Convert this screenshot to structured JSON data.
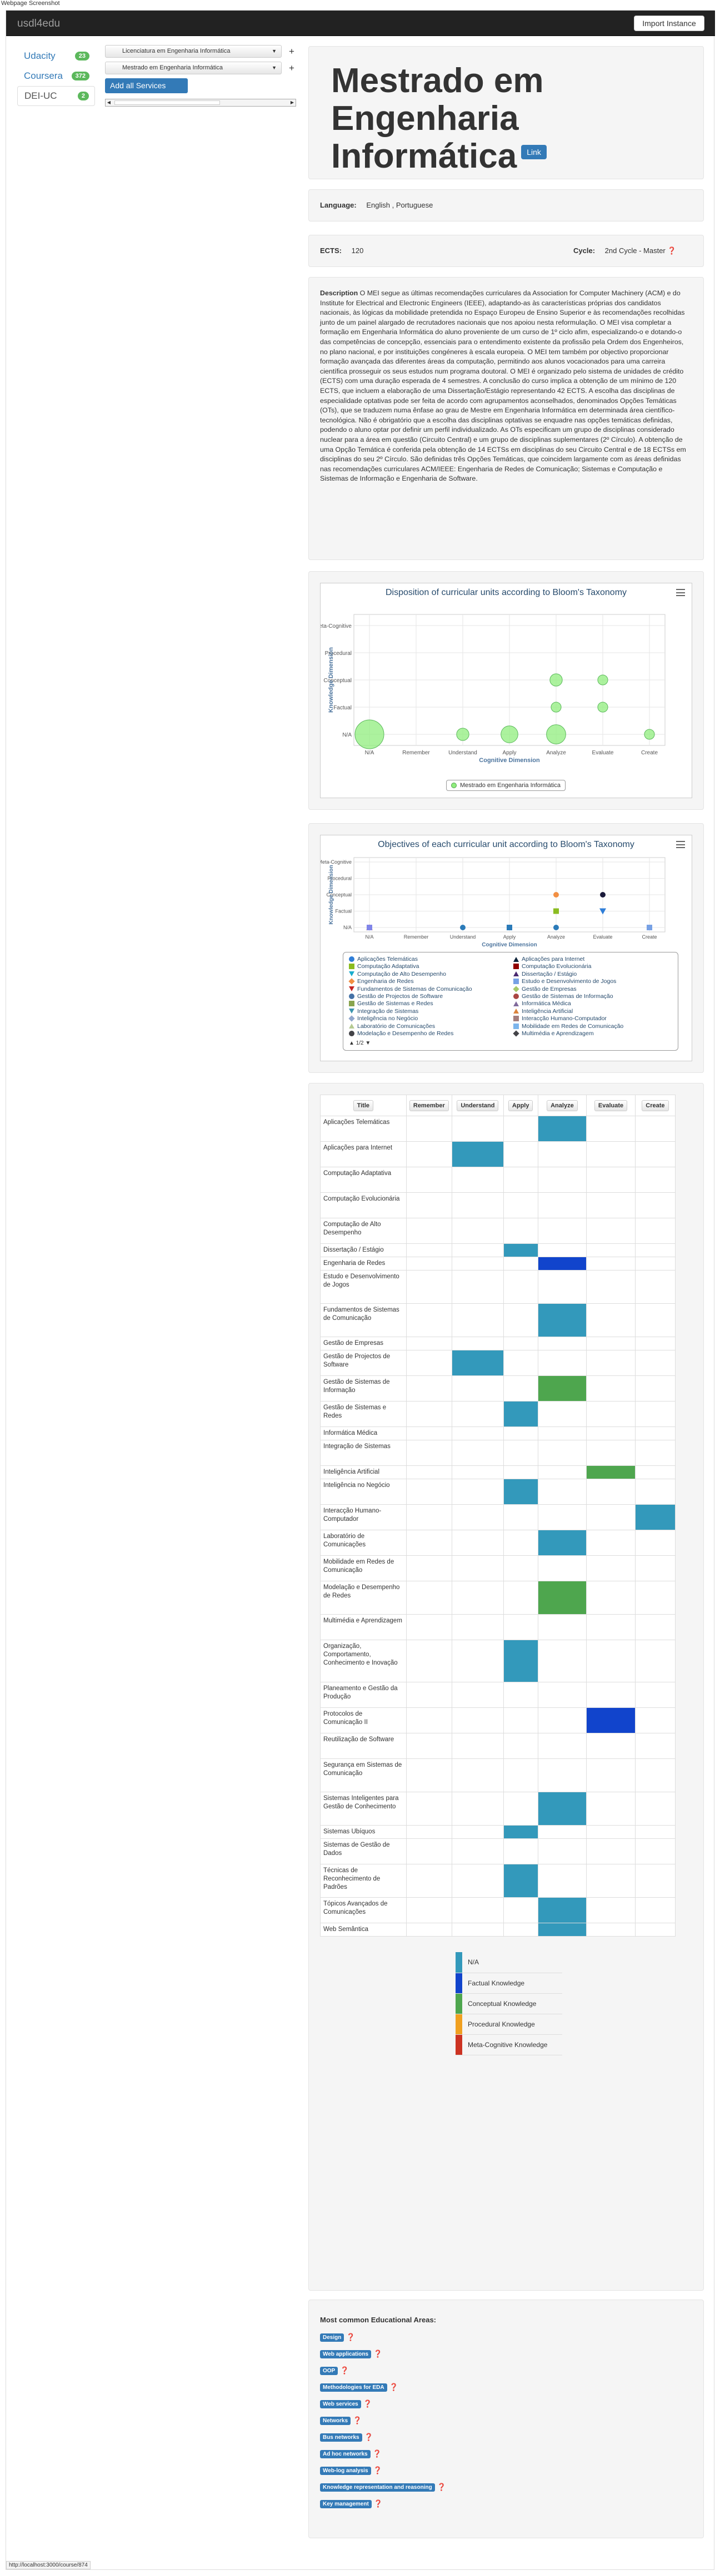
{
  "page_caption": "Webpage Screenshot",
  "navbar": {
    "brand": "usdl4edu",
    "import_button": "Import Instance"
  },
  "sidebar": {
    "items": [
      {
        "label": "Udacity",
        "count": "23"
      },
      {
        "label": "Coursera",
        "count": "372"
      },
      {
        "label": "DEI-UC",
        "count": "2"
      }
    ]
  },
  "courses": {
    "selected": [
      "Licenciatura em Engenharia Informática",
      "Mestrado em Engenharia Informática"
    ],
    "add_button": "Add all Services"
  },
  "header": {
    "title": "Mestrado em Engenharia Informática",
    "link_label": "Link"
  },
  "language": {
    "label": "Language:",
    "value": "English , Portuguese"
  },
  "ects": {
    "label": "ECTS:",
    "value": "120",
    "cycle_label": "Cycle:",
    "cycle_value": "2nd Cycle - Master"
  },
  "description": {
    "label": "Description",
    "text": "O MEI segue as últimas recomendações curriculares da Association for Computer Machinery (ACM) e do Institute for Electrical and Electronic Engineers (IEEE), adaptando-as às características próprias dos candidatos nacionais, às lógicas da mobilidade pretendida no Espaço Europeu de Ensino Superior e às recomendações recolhidas junto de um painel alargado de recrutadores nacionais que nos apoiou nesta reformulação. O MEI visa completar a formação em Engenharia Informática do aluno proveniente de um curso de 1º ciclo afim, especializando-o e dotando-o das competências de concepção, essenciais para o entendimento existente da profissão pela Ordem dos Engenheiros, no plano nacional, e por instituições congéneres à escala europeia. O MEI tem também por objectivo proporcionar formação avançada das diferentes áreas da computação, permitindo aos alunos vocacionados para uma carreira científica prosseguir os seus estudos num programa doutoral. O MEI é organizado pelo sistema de unidades de crédito (ECTS) com uma duração esperada de 4 semestres. A conclusão do curso implica a obtenção de um mínimo de 120 ECTS, que incluem a elaboração de uma Dissertação/Estágio representando 42 ECTS. A escolha das disciplinas de especialidade optativas pode ser feita de acordo com agrupamentos aconselhados, denominados Opções Temáticas (OTs), que se traduzem numa ênfase ao grau de Mestre em Engenharia Informática em determinada área científico-tecnológica. Não é obrigatório que a escolha das disciplinas optativas se enquadre nas opções temáticas definidas, podendo o aluno optar por definir um perfil individualizado. As OTs especificam um grupo de disciplinas considerado nuclear para a área em questão (Circuito Central) e um grupo de disciplinas suplementares (2º Círculo). A obtenção de uma Opção Temática é conferida pela obtenção de 14 ECTSs em disciplinas do seu Circuito Central e de 18 ECTSs em disciplinas do seu 2º Círculo. São definidas três Opções Temáticas, que coincidem largamente com as áreas definidas nas recomendações curriculares ACM/IEEE: Engenharia de Redes de Comunicação; Sistemas e Computação e Sistemas de Informação e Engenharia de Software."
  },
  "chart_data": [
    {
      "type": "scatter",
      "title": "Disposition of curricular units according to Bloom's Taxonomy",
      "xlabel": "Cognitive Dimension",
      "ylabel": "Knowledge Dimension",
      "x_categories": [
        "N/A",
        "Remember",
        "Understand",
        "Apply",
        "Analyze",
        "Evaluate",
        "Create"
      ],
      "y_categories": [
        "N/A",
        "Factual",
        "Conceptual",
        "Procedural",
        "Meta-Cognitive"
      ],
      "series": [
        {
          "name": "Mestrado em Engenharia Informática",
          "color": "#90ed7d",
          "points": [
            {
              "x": "N/A",
              "y": "N/A",
              "size": 19
            },
            {
              "x": "Understand",
              "y": "N/A",
              "size": 2
            },
            {
              "x": "Apply",
              "y": "N/A",
              "size": 5
            },
            {
              "x": "Analyze",
              "y": "N/A",
              "size": 7
            },
            {
              "x": "Create",
              "y": "N/A",
              "size": 1
            },
            {
              "x": "Analyze",
              "y": "Factual",
              "size": 1
            },
            {
              "x": "Evaluate",
              "y": "Factual",
              "size": 1
            },
            {
              "x": "Analyze",
              "y": "Conceptual",
              "size": 2
            },
            {
              "x": "Evaluate",
              "y": "Conceptual",
              "size": 1
            }
          ]
        }
      ]
    },
    {
      "type": "scatter",
      "title": "Objectives of each curricular unit according to Bloom's Taxonomy",
      "xlabel": "Cognitive Dimension",
      "ylabel": "Knowledge Dimension",
      "x_categories": [
        "N/A",
        "Remember",
        "Understand",
        "Apply",
        "Analyze",
        "Evaluate",
        "Create"
      ],
      "y_categories": [
        "N/A",
        "Factual",
        "Conceptual",
        "Procedural",
        "Meta-Cognitive"
      ],
      "points": [
        {
          "x": "N/A",
          "y": "N/A",
          "color": "#f7a35c",
          "shape": "triangle"
        },
        {
          "x": "N/A",
          "y": "N/A",
          "color": "#8085e9",
          "shape": "square"
        },
        {
          "x": "Understand",
          "y": "N/A",
          "color": "#2b7bb9",
          "shape": "circle"
        },
        {
          "x": "Apply",
          "y": "N/A",
          "color": "#2b7bb9",
          "shape": "square"
        },
        {
          "x": "Analyze",
          "y": "N/A",
          "color": "#2b7bb9",
          "shape": "circle"
        },
        {
          "x": "Analyze",
          "y": "Factual",
          "color": "#8bbc21",
          "shape": "square"
        },
        {
          "x": "Evaluate",
          "y": "Factual",
          "color": "#2f7ed8",
          "shape": "triangle-down"
        },
        {
          "x": "Analyze",
          "y": "Conceptual",
          "color": "#f28f43",
          "shape": "circle"
        },
        {
          "x": "Evaluate",
          "y": "Conceptual",
          "color": "#1a1a3a",
          "shape": "circle"
        },
        {
          "x": "Create",
          "y": "N/A",
          "color": "#77a1e5",
          "shape": "square"
        }
      ],
      "legend": {
        "entries": [
          {
            "name": "Aplicações Telemáticas",
            "color": "#2f7ed8",
            "shape": "circle"
          },
          {
            "name": "Aplicações para Internet",
            "color": "#0d233a",
            "shape": "triangle"
          },
          {
            "name": "Computação Adaptativa",
            "color": "#8bbc21",
            "shape": "square"
          },
          {
            "name": "Computação Evolucionária",
            "color": "#910000",
            "shape": "square"
          },
          {
            "name": "Computação de Alto Desempenho",
            "color": "#1aadce",
            "shape": "triangle-down"
          },
          {
            "name": "Dissertação / Estágio",
            "color": "#492970",
            "shape": "triangle"
          },
          {
            "name": "Engenharia de Redes",
            "color": "#f28f43",
            "shape": "diamond"
          },
          {
            "name": "Estudo e Desenvolvimento de Jogos",
            "color": "#77a1e5",
            "shape": "square"
          },
          {
            "name": "Fundamentos de Sistemas de Comunicação",
            "color": "#c42525",
            "shape": "triangle-down"
          },
          {
            "name": "Gestão de Empresas",
            "color": "#a6c96a",
            "shape": "diamond"
          },
          {
            "name": "Gestão de Projectos de Software",
            "color": "#4572a7",
            "shape": "circle"
          },
          {
            "name": "Gestão de Sistemas de Informação",
            "color": "#aa4643",
            "shape": "circle"
          },
          {
            "name": "Gestão de Sistemas e Redes",
            "color": "#89a54e",
            "shape": "square"
          },
          {
            "name": "Informática Médica",
            "color": "#80699b",
            "shape": "triangle"
          },
          {
            "name": "Integração de Sistemas",
            "color": "#3d96ae",
            "shape": "triangle-down"
          },
          {
            "name": "Inteligência Artificial",
            "color": "#db843d",
            "shape": "triangle"
          },
          {
            "name": "Inteligência no Negócio",
            "color": "#92a8cd",
            "shape": "diamond"
          },
          {
            "name": "Interacção Humano-Computador",
            "color": "#a47d7c",
            "shape": "square"
          },
          {
            "name": "Laboratório de Comunicações",
            "color": "#b5ca92",
            "shape": "triangle"
          },
          {
            "name": "Mobilidade em Redes de Comunicação",
            "color": "#7cb5ec",
            "shape": "square"
          },
          {
            "name": "Modelação e Desempenho de Redes",
            "color": "#434348",
            "shape": "circle"
          },
          {
            "name": "Multimédia e Aprendizagem",
            "color": "#434348",
            "shape": "diamond"
          }
        ],
        "pager": "1/2"
      }
    }
  ],
  "table": {
    "headers": [
      "Title",
      "Remember",
      "Understand",
      "Apply",
      "Analyze",
      "Evaluate",
      "Create"
    ],
    "rows": [
      {
        "title": "Aplicações Telemáticas",
        "cells": [
          "",
          "",
          "",
          "c0",
          "",
          ""
        ],
        "h": 2
      },
      {
        "title": "Aplicações para Internet",
        "cells": [
          "",
          "c0",
          "",
          "",
          "",
          ""
        ],
        "h": 2
      },
      {
        "title": "Computação Adaptativa",
        "cells": [
          "",
          "",
          "",
          "",
          "",
          ""
        ],
        "h": 2
      },
      {
        "title": "Computação Evolucionária",
        "cells": [
          "",
          "",
          "",
          "",
          "",
          ""
        ],
        "h": 2
      },
      {
        "title": "Computação de Alto Desempenho",
        "cells": [
          "",
          "",
          "",
          "",
          "",
          ""
        ],
        "h": 2
      },
      {
        "title": "Dissertação / Estágio",
        "cells": [
          "",
          "",
          "c0",
          "",
          "",
          ""
        ],
        "h": 1
      },
      {
        "title": "Engenharia de Redes",
        "cells": [
          "",
          "",
          "",
          "c1",
          "",
          ""
        ],
        "h": 1
      },
      {
        "title": "Estudo e Desenvolvimento de Jogos",
        "cells": [
          "",
          "",
          "",
          "",
          "",
          ""
        ],
        "h": 3
      },
      {
        "title": "Fundamentos de Sistemas de Comunicação",
        "cells": [
          "",
          "",
          "",
          "c0",
          "",
          ""
        ],
        "h": 3
      },
      {
        "title": "Gestão de Empresas",
        "cells": [
          "",
          "",
          "",
          "",
          "",
          ""
        ],
        "h": 1
      },
      {
        "title": "Gestão de Projectos de Software",
        "cells": [
          "",
          "c0",
          "",
          "",
          "",
          ""
        ],
        "h": 2
      },
      {
        "title": "Gestão de Sistemas de Informação",
        "cells": [
          "",
          "",
          "",
          "c2",
          "",
          ""
        ],
        "h": 2
      },
      {
        "title": "Gestão de Sistemas e Redes",
        "cells": [
          "",
          "",
          "c0",
          "",
          "",
          ""
        ],
        "h": 2
      },
      {
        "title": "Informática Médica",
        "cells": [
          "",
          "",
          "",
          "",
          "",
          ""
        ],
        "h": 1
      },
      {
        "title": "Integração de Sistemas",
        "cells": [
          "",
          "",
          "",
          "",
          "",
          ""
        ],
        "h": 2
      },
      {
        "title": "Inteligência Artificial",
        "cells": [
          "",
          "",
          "",
          "",
          "c2",
          ""
        ],
        "h": 1
      },
      {
        "title": "Inteligência no Negócio",
        "cells": [
          "",
          "",
          "c0",
          "",
          "",
          ""
        ],
        "h": 2
      },
      {
        "title": "Interacção Humano-Computador",
        "cells": [
          "",
          "",
          "",
          "",
          "",
          "c0"
        ],
        "h": 2
      },
      {
        "title": "Laboratório de Comunicações",
        "cells": [
          "",
          "",
          "",
          "c0",
          "",
          ""
        ],
        "h": 2
      },
      {
        "title": "Mobilidade em Redes de Comunicação",
        "cells": [
          "",
          "",
          "",
          "",
          "",
          ""
        ],
        "h": 2
      },
      {
        "title": "Modelação e Desempenho de Redes",
        "cells": [
          "",
          "",
          "",
          "c2",
          "",
          ""
        ],
        "h": 3
      },
      {
        "title": "Multimédia e Aprendizagem",
        "cells": [
          "",
          "",
          "",
          "",
          "",
          ""
        ],
        "h": 2
      },
      {
        "title": "Organização, Comportamento, Conhecimento e Inovação",
        "cells": [
          "",
          "",
          "c0",
          "",
          "",
          ""
        ],
        "h": 4
      },
      {
        "title": "Planeamento e Gestão da Produção",
        "cells": [
          "",
          "",
          "",
          "",
          "",
          ""
        ],
        "h": 2
      },
      {
        "title": "Protocolos de Comunicação II",
        "cells": [
          "",
          "",
          "",
          "",
          "c1",
          ""
        ],
        "h": 2
      },
      {
        "title": "Reutilização de Software",
        "cells": [
          "",
          "",
          "",
          "",
          "",
          ""
        ],
        "h": 2
      },
      {
        "title": "Segurança em Sistemas de Comunicação",
        "cells": [
          "",
          "",
          "",
          "",
          "",
          ""
        ],
        "h": 3
      },
      {
        "title": "Sistemas Inteligentes para Gestão de Conhecimento",
        "cells": [
          "",
          "",
          "",
          "c0",
          "",
          ""
        ],
        "h": 3
      },
      {
        "title": "Sistemas Ubíquos",
        "cells": [
          "",
          "",
          "c0",
          "",
          "",
          ""
        ],
        "h": 1
      },
      {
        "title": "Sistemas de Gestão de Dados",
        "cells": [
          "",
          "",
          "",
          "",
          "",
          ""
        ],
        "h": 2
      },
      {
        "title": "Técnicas de Reconhecimento de Padrões",
        "cells": [
          "",
          "",
          "c0",
          "",
          "",
          ""
        ],
        "h": 3
      },
      {
        "title": "Tópicos Avançados de Comunicações",
        "cells": [
          "",
          "",
          "",
          "c0",
          "",
          ""
        ],
        "h": 2
      },
      {
        "title": "Web Semântica",
        "cells": [
          "",
          "",
          "",
          "c0",
          "",
          ""
        ],
        "h": 1
      }
    ],
    "legend": [
      {
        "label": "N/A",
        "color": "#3399bb"
      },
      {
        "label": "Factual Knowledge",
        "color": "#1144cc"
      },
      {
        "label": "Conceptual Knowledge",
        "color": "#4ea64e"
      },
      {
        "label": "Procedural Knowledge",
        "color": "#f0a020"
      },
      {
        "label": "Meta-Cognitive Knowledge",
        "color": "#cc3322"
      }
    ]
  },
  "areas": {
    "title": "Most common Educational Areas:",
    "items": [
      "Design",
      "Web applications",
      "OOP",
      "Methodologies for EDA",
      "Web services",
      "Networks",
      "Bus networks",
      "Ad hoc networks",
      "Web-log analysis",
      "Knowledge representation and reasoning",
      "Key management"
    ]
  },
  "status_url": "http://localhost:3000/course/874"
}
